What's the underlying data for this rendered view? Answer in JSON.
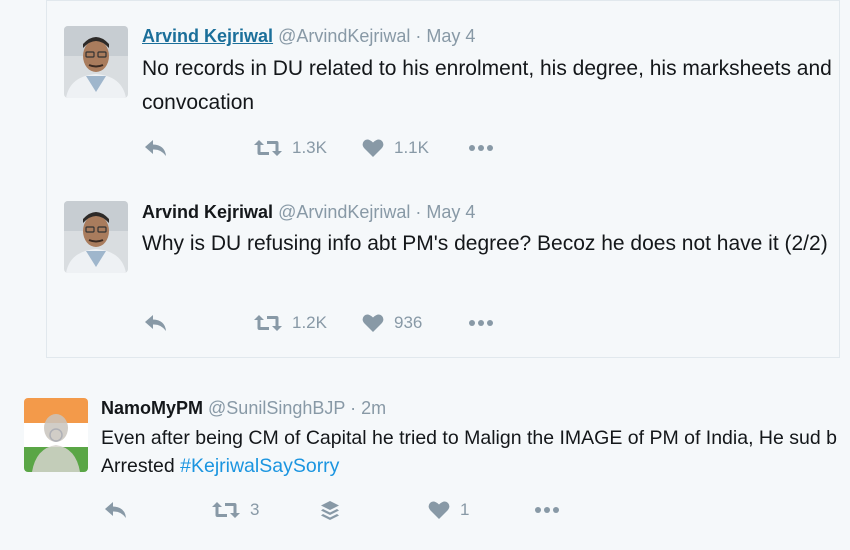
{
  "tweets": [
    {
      "name": "Arvind Kejriwal",
      "handle": "@ArvindKejriwal",
      "separator": "·",
      "time": "May 4",
      "text": "No records in DU related to his enrolment, his degree, his marksheets and convocation",
      "retweets": "1.3K",
      "likes": "1.1K"
    },
    {
      "name": "Arvind Kejriwal",
      "handle": "@ArvindKejriwal",
      "separator": "·",
      "time": "May 4",
      "text": "Why is DU refusing info abt PM's degree? Becoz he does not have it (2/2)",
      "retweets": "1.2K",
      "likes": "936"
    }
  ],
  "reply": {
    "name": "NamoMyPM",
    "handle": "@SunilSinghBJP",
    "separator": "·",
    "time": "2m",
    "text": "Even after being CM of Capital he tried to Malign the IMAGE of PM of India, He sud b Arrested",
    "hashtag": "#KejriwalSaySorry",
    "retweets": "3",
    "likes": "1"
  },
  "icons": {
    "reply": "reply-icon",
    "retweet": "retweet-icon",
    "like": "heart-icon",
    "more": "more-dots-icon",
    "buffer": "buffer-stack-icon"
  },
  "colors": {
    "icon_gray": "#8899a6",
    "link_blue": "#1b6f9a",
    "hashtag_blue": "#1b95e0",
    "background": "#f5f8fa"
  }
}
